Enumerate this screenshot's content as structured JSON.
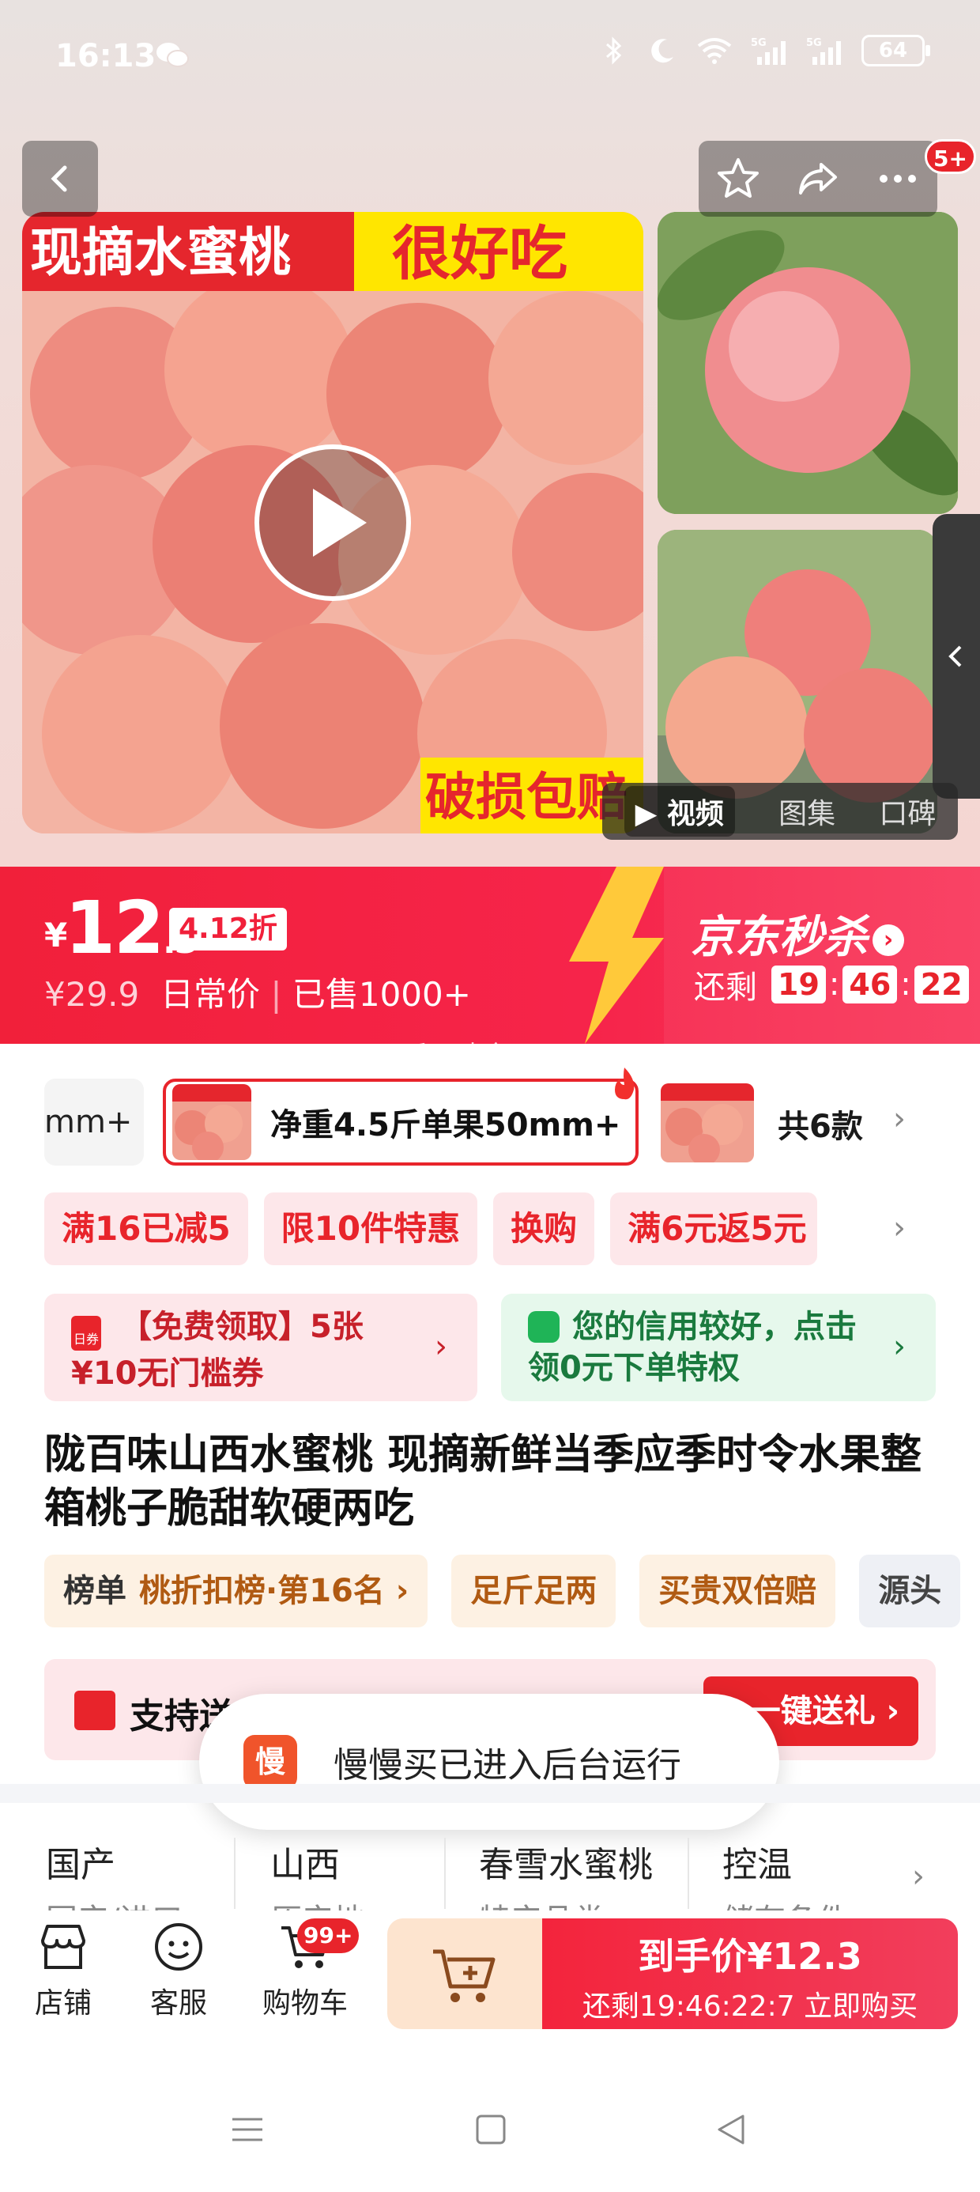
{
  "status_bar": {
    "time": "16:13",
    "battery": "64",
    "icons": [
      "wechat-icon",
      "bluetooth-icon",
      "moon-icon",
      "wifi-icon",
      "signal-5g-icon",
      "signal-5g-icon",
      "battery-icon"
    ]
  },
  "top_nav": {
    "back_icon": "chevron-left-icon",
    "favorite_icon": "star-icon",
    "share_icon": "share-icon",
    "more_icon": "more-dots-icon",
    "message_badge": "5+"
  },
  "gallery": {
    "main_banner_left": "现摘水蜜桃",
    "main_banner_right": "很好吃",
    "main_banner_bottom": "破损包赔",
    "media_tabs": [
      {
        "label": "视频",
        "active": true
      },
      {
        "label": "图集",
        "active": false
      },
      {
        "label": "口碑",
        "active": false
      }
    ]
  },
  "price_banner": {
    "currency": "¥",
    "price_int": "12",
    "price_dec": ".3",
    "discount": "4.12折",
    "original_price": "¥29.9",
    "daily_label": "日常价",
    "sold": "已售1000+",
    "seckill_title": "京东秒杀",
    "remaining_label": "还剩",
    "countdown": {
      "h": "19",
      "m": "46",
      "s": "22"
    },
    "watermark": "乏不吵命"
  },
  "variants": {
    "prev_label": "mm+",
    "active_label": "净重4.5斤单果50mm+",
    "count_label": "共6款"
  },
  "promos": [
    "满16已减5",
    "限10件特惠",
    "换购",
    "满6元返5元"
  ],
  "coupons": {
    "left": {
      "icon_text": "日券",
      "line1": "【免费领取】5张",
      "line2": "¥10无门槛券"
    },
    "right": {
      "text": "您的信用较好，点击领0元下单特权"
    }
  },
  "product": {
    "title": "陇百味山西水蜜桃 现摘新鲜当季应季时令水果整箱桃子脆甜软硬两吃"
  },
  "chips": [
    {
      "key": "榜单",
      "label": "桃折扣榜·第16名 ›"
    },
    {
      "key": "",
      "label": "足斤足两"
    },
    {
      "key": "",
      "label": "买贵双倍赔"
    },
    {
      "key": "",
      "label": "源头"
    }
  ],
  "gift_bar": {
    "label": "支持送",
    "button": "一键送礼 ›"
  },
  "toast": {
    "app_icon_text": "慢",
    "message": "慢慢买已进入后台运行"
  },
  "attributes": [
    {
      "name": "国产",
      "sub": "国产/进口"
    },
    {
      "name": "山西",
      "sub": "原产地"
    },
    {
      "name": "春雪水蜜桃",
      "sub": "特产品类"
    },
    {
      "name": "控温",
      "sub": "储存条件"
    }
  ],
  "bottom_bar": {
    "store": "店铺",
    "service": "客服",
    "cart": "购物车",
    "cart_badge": "99+",
    "buy_line1": "到手价¥12.3",
    "buy_line2": "还剩19:46:22:7  立即购买"
  },
  "colors": {
    "accent_red": "#e8242b",
    "seckill_gradient_start": "#f1203a",
    "coupon_green": "#1fb457"
  }
}
